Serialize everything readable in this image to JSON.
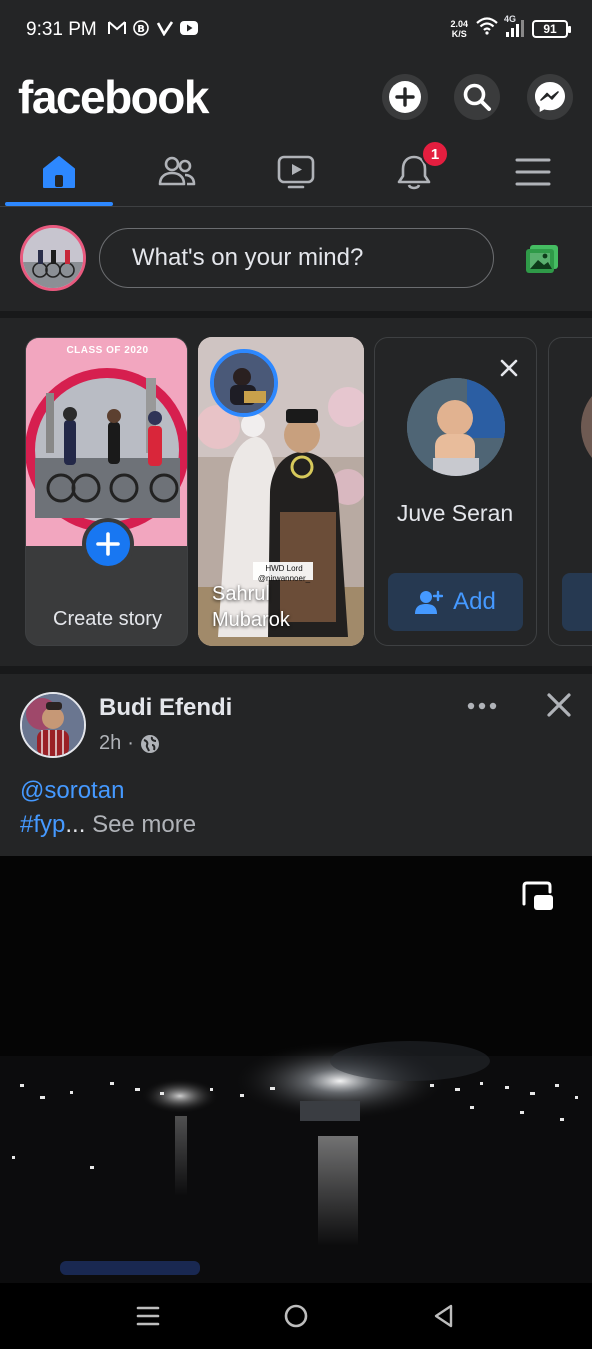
{
  "status_bar": {
    "time": "9:31 PM",
    "app_icons": [
      "gmail-icon",
      "b-icon",
      "v-icon",
      "youtube-icon"
    ],
    "speed_value": "2.04",
    "speed_unit": "K/S",
    "network": "4G",
    "battery": "91"
  },
  "header": {
    "logo": "facebook",
    "actions": [
      "create-icon",
      "search-icon",
      "messenger-icon"
    ]
  },
  "tabs": [
    {
      "name": "home",
      "icon": "home-icon",
      "active": true
    },
    {
      "name": "friends",
      "icon": "friends-icon",
      "active": false
    },
    {
      "name": "watch",
      "icon": "watch-icon",
      "active": false
    },
    {
      "name": "notifications",
      "icon": "bell-icon",
      "active": false,
      "badge": "1"
    },
    {
      "name": "menu",
      "icon": "hamburger-icon",
      "active": false
    }
  ],
  "composer": {
    "placeholder": "What's on your mind?"
  },
  "stories": {
    "create_label": "Create story",
    "create_photo_text": "CLASS OF 2020",
    "story": {
      "name_line1": "Sahrul",
      "name_line2": "Mubarok",
      "caption": "HWD Lord @nirwannoer_"
    },
    "suggestion": {
      "name": "Juve Seran",
      "add_label": "Add"
    }
  },
  "post": {
    "author": "Budi Efendi",
    "time": "2h",
    "separator": "·",
    "mention": "@sorotan",
    "hashtag": "#fyp",
    "ellipsis": "...",
    "see_more": "See more"
  },
  "colors": {
    "background": "#18191a",
    "surface": "#242526",
    "accent": "#2d88ff",
    "badge": "#e41e3f",
    "photo_green": "#45bd62"
  }
}
